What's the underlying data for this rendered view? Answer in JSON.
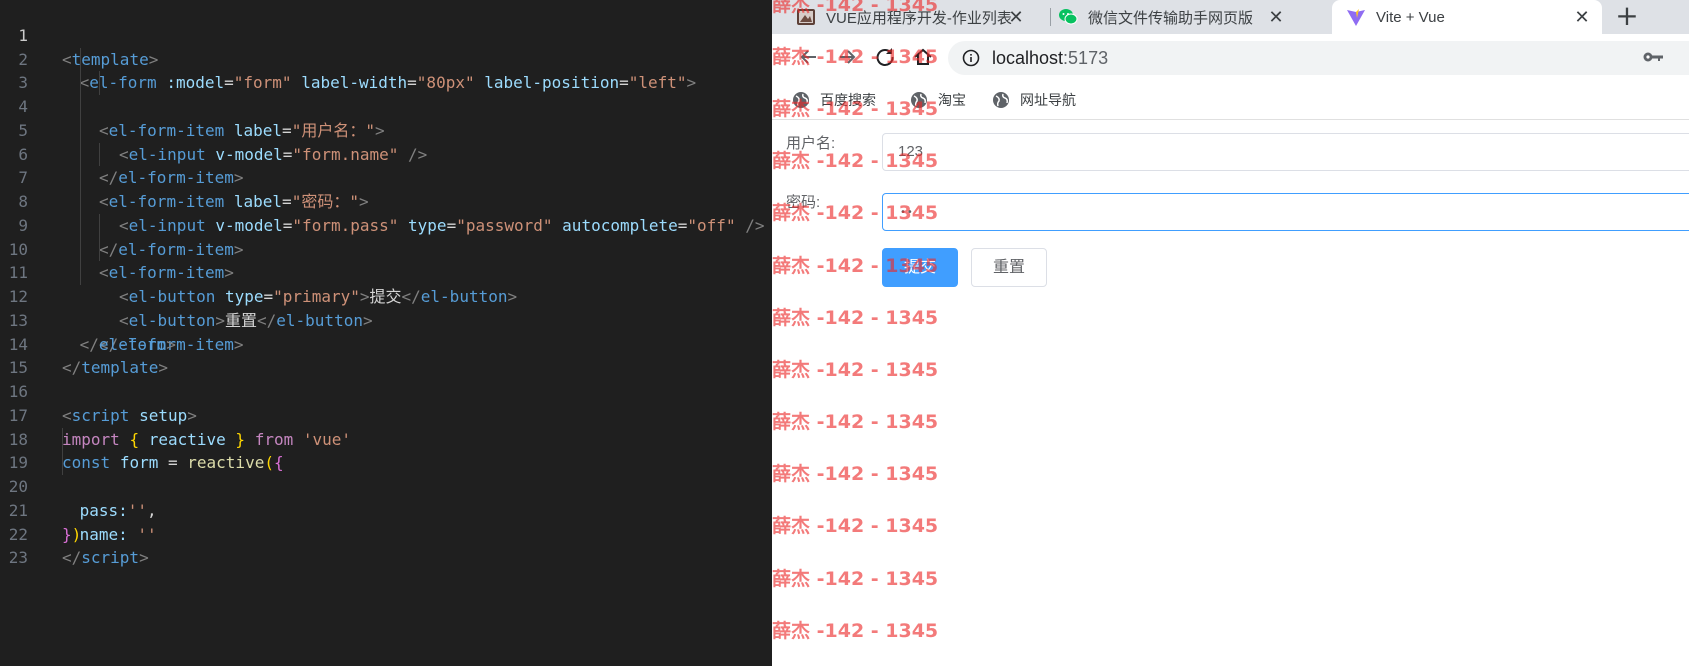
{
  "editor": {
    "active_line": 1,
    "line_numbers": [
      "1",
      "2",
      "3",
      "4",
      "5",
      "6",
      "7",
      "8",
      "9",
      "10",
      "11",
      "12",
      "13",
      "14",
      "15",
      "16",
      "17",
      "18",
      "19",
      "20",
      "21",
      "22",
      "23"
    ],
    "tokens": {
      "l1": {
        "open": "<",
        "tag": "template",
        "close": ">"
      },
      "l2": {
        "open": "<",
        "tag": "el-form",
        "a1": ":model",
        "eq1": "=",
        "v1": "\"form\"",
        "a2": "label-width",
        "eq2": "=",
        "v2": "\"80px\"",
        "a3": "label-position",
        "eq3": "=",
        "v3": "\"left\"",
        "close": ">"
      },
      "l3": {
        "open": "<",
        "tag": "el-form-item",
        "a1": "label",
        "eq1": "=",
        "v1": "\"用户名：\"",
        "close": ">"
      },
      "l4": {
        "open": "<",
        "tag": "el-input",
        "a1": "v-model",
        "eq1": "=",
        "v1": "\"form.name\"",
        "close": "/>"
      },
      "l5": {
        "open": "</",
        "tag": "el-form-item",
        "close": ">"
      },
      "l6": {
        "open": "<",
        "tag": "el-form-item",
        "a1": "label",
        "eq1": "=",
        "v1": "\"密码：\"",
        "close": ">"
      },
      "l7": {
        "open": "<",
        "tag": "el-input",
        "a1": "v-model",
        "eq1": "=",
        "v1": "\"form.pass\"",
        "a2": "type",
        "eq2": "=",
        "v2": "\"password\"",
        "a3": "autocomplete",
        "eq3": "=",
        "v3": "\"off\"",
        "close": "/>"
      },
      "l8": {
        "open": "</",
        "tag": "el-form-item",
        "close": ">"
      },
      "l9": {
        "open": "<",
        "tag": "el-form-item",
        "close": ">"
      },
      "l10": {
        "open": "<",
        "tag": "el-button",
        "a1": "type",
        "eq1": "=",
        "v1": "\"primary\"",
        "close": ">",
        "text": "提交",
        "open2": "</",
        "tag2": "el-button",
        "close2": ">"
      },
      "l11": {
        "open": "<",
        "tag": "el-button",
        "close": ">",
        "text": "重置",
        "open2": "</",
        "tag2": "el-button",
        "close2": ">"
      },
      "l12": {
        "open": "</",
        "tag": "el-form-item",
        "close": ">"
      },
      "l13": {
        "open": "</",
        "tag": "el-form",
        "close": ">"
      },
      "l14": {
        "open": "</",
        "tag": "template",
        "close": ">"
      },
      "l16": {
        "open": "<",
        "tag": "script",
        "a1": "setup",
        "close": ">"
      },
      "l17": {
        "kw1": "import",
        "b1": "{",
        "name": "reactive",
        "b2": "}",
        "kw2": "from",
        "str": "'vue'"
      },
      "l18": {
        "decl": "const",
        "var": "form",
        "op": "=",
        "fn": "reactive",
        "p1": "(",
        "b1": "{"
      },
      "l19": {
        "key": "pass:",
        "str": "''",
        "comma": ","
      },
      "l20": {
        "key": "name:",
        "str": "''"
      },
      "l21": {
        "b1": "}",
        "p1": ")"
      },
      "l22": {
        "open": "</",
        "tag": "script",
        "close": ">"
      }
    }
  },
  "browser": {
    "tabs": [
      {
        "title": "VUE应用程序开发-作业列表",
        "close": "✕"
      },
      {
        "title": "微信文件传输助手网页版",
        "close": "✕"
      },
      {
        "title": "Vite + Vue",
        "close": "✕"
      }
    ],
    "new_tab": "+",
    "url_host": "localhost",
    "url_port": ":5173",
    "bookmarks": [
      "百度搜索",
      "淘宝",
      "网址导航"
    ],
    "form": {
      "username_label": "用户名:",
      "username_value": "123",
      "password_label": "密码:",
      "password_value": "••",
      "submit_label": "提交",
      "reset_label": "重置"
    },
    "colors": {
      "primary": "#409eff",
      "focus_border": "#409eff"
    }
  },
  "watermark": "薛杰 -142 - 1345"
}
